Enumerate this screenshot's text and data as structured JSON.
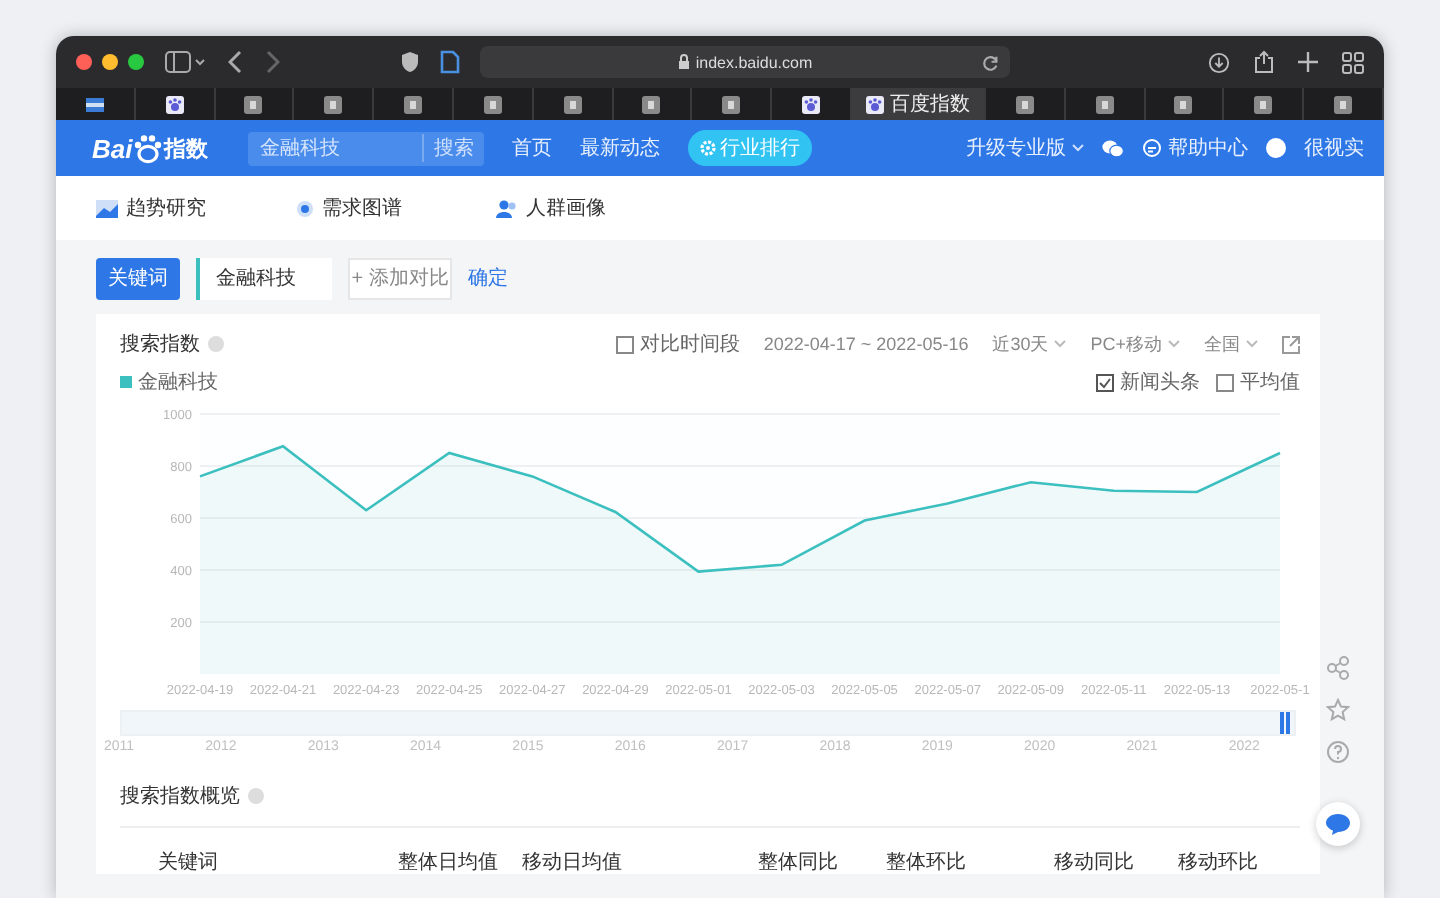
{
  "browser": {
    "url": "index.baidu.com",
    "tabs": [
      {
        "kind": "bar",
        "selected": false
      },
      {
        "kind": "paw",
        "selected": false
      },
      {
        "kind": "letter",
        "selected": false
      },
      {
        "kind": "letter",
        "selected": false
      },
      {
        "kind": "letter",
        "selected": false
      },
      {
        "kind": "letter",
        "selected": false
      },
      {
        "kind": "letter",
        "selected": false
      },
      {
        "kind": "letter",
        "selected": false
      },
      {
        "kind": "letter",
        "selected": false
      },
      {
        "kind": "paw",
        "selected": false
      },
      {
        "kind": "paw",
        "label": "百度指数",
        "selected": true
      },
      {
        "kind": "letter",
        "selected": false
      },
      {
        "kind": "letter",
        "selected": false
      },
      {
        "kind": "letter",
        "selected": false
      },
      {
        "kind": "letter",
        "selected": false
      },
      {
        "kind": "letter",
        "selected": false
      }
    ]
  },
  "header": {
    "logo_left": "Bai",
    "logo_right": "指数",
    "search": {
      "value": "金融科技",
      "button": "搜索"
    },
    "nav": [
      {
        "label": "首页",
        "selected": false
      },
      {
        "label": "最新动态",
        "selected": false
      },
      {
        "label": "行业排行",
        "selected": true
      }
    ],
    "right": [
      {
        "kind": "upgrade",
        "label": "升级专业版"
      },
      {
        "kind": "wechat"
      },
      {
        "kind": "help",
        "label": "帮助中心"
      },
      {
        "kind": "user",
        "label": "很视实"
      }
    ]
  },
  "subnav": [
    {
      "kind": "trend",
      "label": "趋势研究"
    },
    {
      "kind": "map",
      "label": "需求图谱"
    },
    {
      "kind": "people",
      "label": "人群画像"
    }
  ],
  "keyword_bar": {
    "tag": "关键词",
    "keyword": "金融科技",
    "add": "+ 添加对比",
    "confirm": "确定"
  },
  "index_panel": {
    "title": "搜索指数",
    "compare": {
      "label": "对比时间段",
      "checked": false
    },
    "date_range": "2022-04-17 ~ 2022-05-16",
    "period": "近30天",
    "device": "PC+移动",
    "region": "全国",
    "options": [
      {
        "label": "新闻头条",
        "checked": true
      },
      {
        "label": "平均值",
        "checked": false
      }
    ],
    "chart_data": {
      "type": "area",
      "categories": [
        "2022-04-19",
        "2022-04-21",
        "2022-04-23",
        "2022-04-25",
        "2022-04-27",
        "2022-04-29",
        "2022-05-01",
        "2022-05-03",
        "2022-05-05",
        "2022-05-07",
        "2022-05-09",
        "2022-05-11",
        "2022-05-13",
        "2022-05-1"
      ],
      "series": [
        {
          "name": "金融科技",
          "color": "#3cbfbf",
          "values": [
            760,
            876,
            630,
            850,
            760,
            623,
            394,
            420,
            590,
            656,
            738,
            705,
            700,
            850
          ]
        }
      ],
      "ylim": [
        0,
        1000
      ],
      "yticks": [
        200,
        400,
        600,
        800,
        1000
      ],
      "grid": true
    },
    "timeline": {
      "years": [
        "2011",
        "2012",
        "2013",
        "2014",
        "2015",
        "2016",
        "2017",
        "2018",
        "2019",
        "2020",
        "2021",
        "2022"
      ],
      "level": 1
    }
  },
  "overview": {
    "title": "搜索指数概览",
    "columns": [
      "关键词",
      "整体日均值",
      "移动日均值",
      "整体同比",
      "整体环比",
      "移动同比",
      "移动环比"
    ]
  }
}
